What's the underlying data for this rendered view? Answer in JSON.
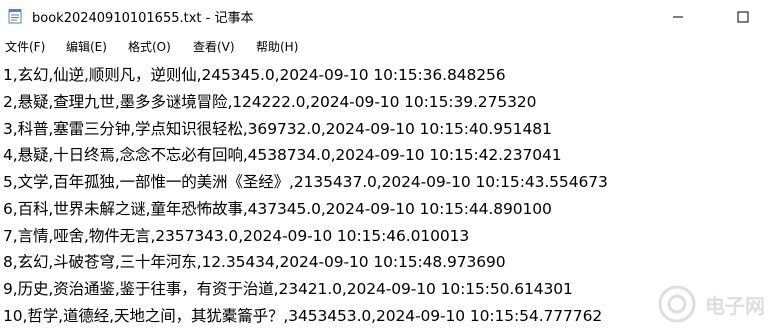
{
  "window": {
    "title": "book20240910101655.txt - 记事本",
    "icon": "notepad-icon"
  },
  "menu": {
    "items": [
      "文件(F)",
      "编辑(E)",
      "格式(O)",
      "查看(V)",
      "帮助(H)"
    ]
  },
  "editor": {
    "lines": [
      "1,玄幻,仙逆,顺则凡，逆则仙,245345.0,2024-09-10 10:15:36.848256",
      "2,悬疑,查理九世,墨多多谜境冒险,124222.0,2024-09-10 10:15:39.275320",
      "3,科普,塞雷三分钟,学点知识很轻松,369732.0,2024-09-10 10:15:40.951481",
      "4,悬疑,十日终焉,念念不忘必有回响,4538734.0,2024-09-10 10:15:42.237041",
      "5,文学,百年孤独,一部惟一的美洲《圣经》,2135437.0,2024-09-10 10:15:43.554673",
      "6,百科,世界未解之谜,童年恐怖故事,437345.0,2024-09-10 10:15:44.890100",
      "7,言情,哑舍,物件无言,2357343.0,2024-09-10 10:15:46.010013",
      "8,玄幻,斗破苍穹,三十年河东,12.35434,2024-09-10 10:15:48.973690",
      "9,历史,资治通鉴,鉴于往事，有资于治道,23421.0,2024-09-10 10:15:50.614301",
      "10,哲学,道德经,天地之间，其犹橐籥乎？,3453453.0,2024-09-10 10:15:54.777762"
    ]
  },
  "watermark": {
    "text": "电子网"
  }
}
